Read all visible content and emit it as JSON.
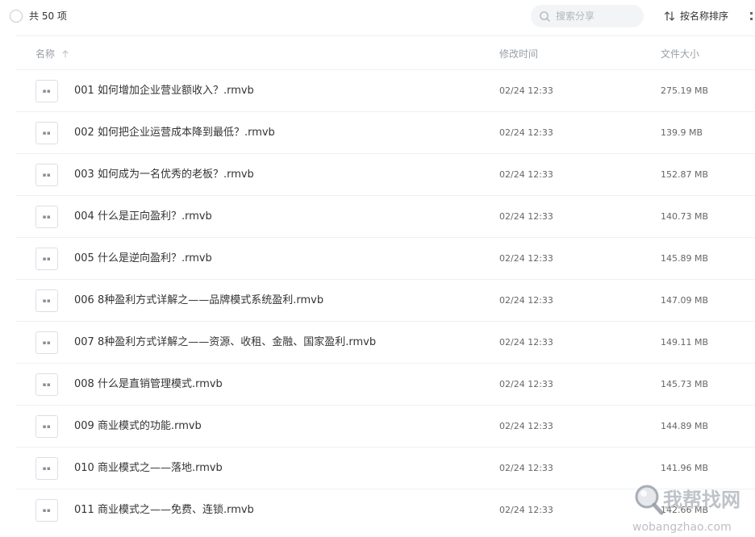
{
  "toolbar": {
    "count_label": "共 50 项",
    "search_placeholder": "搜索分享",
    "sort_label": "按名称排序"
  },
  "columns": {
    "name": "名称",
    "time": "修改时间",
    "size": "文件大小"
  },
  "file_icon_glyph": "▪▪",
  "files": [
    {
      "name": "001 如何增加企业营业额收入？.rmvb",
      "time": "02/24 12:33",
      "size": "275.19 MB"
    },
    {
      "name": "002 如何把企业运营成本降到最低？.rmvb",
      "time": "02/24 12:33",
      "size": "139.9 MB"
    },
    {
      "name": "003 如何成为一名优秀的老板？.rmvb",
      "time": "02/24 12:33",
      "size": "152.87 MB"
    },
    {
      "name": "004 什么是正向盈利？.rmvb",
      "time": "02/24 12:33",
      "size": "140.73 MB"
    },
    {
      "name": "005 什么是逆向盈利？.rmvb",
      "time": "02/24 12:33",
      "size": "145.89 MB"
    },
    {
      "name": "006 8种盈利方式详解之——品牌模式系统盈利.rmvb",
      "time": "02/24 12:33",
      "size": "147.09 MB"
    },
    {
      "name": "007 8种盈利方式详解之——资源、收租、金融、国家盈利.rmvb",
      "time": "02/24 12:33",
      "size": "149.11 MB"
    },
    {
      "name": "008 什么是直销管理模式.rmvb",
      "time": "02/24 12:33",
      "size": "145.73 MB"
    },
    {
      "name": "009 商业模式的功能.rmvb",
      "time": "02/24 12:33",
      "size": "144.89 MB"
    },
    {
      "name": "010 商业模式之——落地.rmvb",
      "time": "02/24 12:33",
      "size": "141.96 MB"
    },
    {
      "name": "011 商业模式之——免费、连锁.rmvb",
      "time": "02/24 12:33",
      "size": "142.66 MB"
    }
  ],
  "watermark": {
    "cn": "我帮找网",
    "url": "wobangzhao.com"
  },
  "colors": {
    "text": "#333333",
    "muted": "#9aa0a8",
    "search_bg": "#f3f4f6",
    "divider": "#eef0f2"
  },
  "icons": {
    "select_all": "radio-circle-icon",
    "search": "search-icon",
    "sort": "sort-arrows-icon",
    "sort_direction": "arrow-up-icon",
    "more": "more-vertical-icon",
    "file": "video-file-icon",
    "watermark_logo": "magnifier-logo-icon"
  }
}
